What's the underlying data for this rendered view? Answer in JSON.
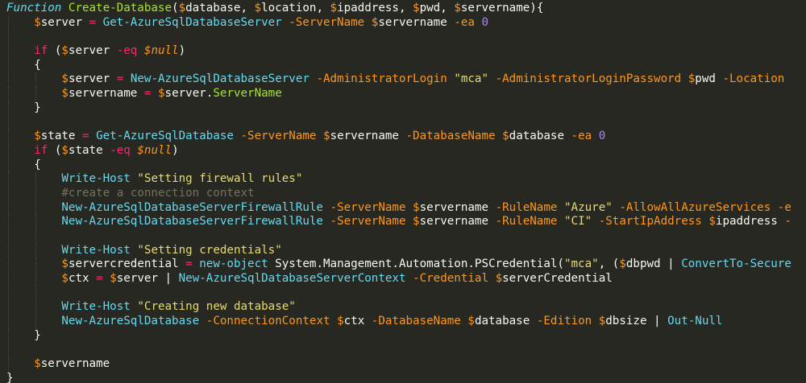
{
  "editor": {
    "theme_colors": {
      "background": "#272822",
      "keyword": "#f92672",
      "function_name": "#a6e22e",
      "cmdlet": "#66d9ef",
      "parameter": "#fd971f",
      "string": "#e6db74",
      "number": "#ae81ff",
      "comment": "#75715e",
      "text": "#f8f8f2"
    },
    "lines": [
      {
        "indent": 0,
        "tokens": [
          {
            "t": "kwi",
            "v": "Function"
          },
          {
            "t": "pun",
            "v": " "
          },
          {
            "t": "fn",
            "v": "Create-Database"
          },
          {
            "t": "pun",
            "v": "("
          },
          {
            "t": "sig",
            "v": "$"
          },
          {
            "t": "var",
            "v": "database"
          },
          {
            "t": "pun",
            "v": ", "
          },
          {
            "t": "sig",
            "v": "$"
          },
          {
            "t": "var",
            "v": "location"
          },
          {
            "t": "pun",
            "v": ", "
          },
          {
            "t": "sig",
            "v": "$"
          },
          {
            "t": "var",
            "v": "ipaddress"
          },
          {
            "t": "pun",
            "v": ", "
          },
          {
            "t": "sig",
            "v": "$"
          },
          {
            "t": "var",
            "v": "pwd"
          },
          {
            "t": "pun",
            "v": ", "
          },
          {
            "t": "sig",
            "v": "$"
          },
          {
            "t": "var",
            "v": "servername"
          },
          {
            "t": "pun",
            "v": "){"
          }
        ]
      },
      {
        "indent": 1,
        "tokens": [
          {
            "t": "sig",
            "v": "$"
          },
          {
            "t": "var",
            "v": "server"
          },
          {
            "t": "pun",
            "v": " "
          },
          {
            "t": "kw",
            "v": "="
          },
          {
            "t": "pun",
            "v": " "
          },
          {
            "t": "cmd",
            "v": "Get-AzureSqlDatabaseServer"
          },
          {
            "t": "pun",
            "v": " "
          },
          {
            "t": "par",
            "v": "-ServerName"
          },
          {
            "t": "pun",
            "v": " "
          },
          {
            "t": "sig",
            "v": "$"
          },
          {
            "t": "var",
            "v": "servername"
          },
          {
            "t": "pun",
            "v": " "
          },
          {
            "t": "par",
            "v": "-ea"
          },
          {
            "t": "pun",
            "v": " "
          },
          {
            "t": "num",
            "v": "0"
          }
        ]
      },
      {
        "indent": 1,
        "tokens": []
      },
      {
        "indent": 1,
        "tokens": [
          {
            "t": "kw",
            "v": "if"
          },
          {
            "t": "pun",
            "v": " ("
          },
          {
            "t": "sig",
            "v": "$"
          },
          {
            "t": "var",
            "v": "server"
          },
          {
            "t": "pun",
            "v": " "
          },
          {
            "t": "kw",
            "v": "-eq"
          },
          {
            "t": "pun",
            "v": " "
          },
          {
            "t": "sigi",
            "v": "$"
          },
          {
            "t": "sigi",
            "v": "null"
          },
          {
            "t": "pun",
            "v": ")"
          }
        ]
      },
      {
        "indent": 1,
        "tokens": [
          {
            "t": "pun",
            "v": "{"
          }
        ]
      },
      {
        "indent": 2,
        "tokens": [
          {
            "t": "sig",
            "v": "$"
          },
          {
            "t": "var",
            "v": "server"
          },
          {
            "t": "pun",
            "v": " "
          },
          {
            "t": "kw",
            "v": "="
          },
          {
            "t": "pun",
            "v": " "
          },
          {
            "t": "cmd",
            "v": "New-AzureSqlDatabaseServer"
          },
          {
            "t": "pun",
            "v": " "
          },
          {
            "t": "par",
            "v": "-AdministratorLogin"
          },
          {
            "t": "pun",
            "v": " "
          },
          {
            "t": "str",
            "v": "\"mca\""
          },
          {
            "t": "pun",
            "v": " "
          },
          {
            "t": "par",
            "v": "-AdministratorLoginPassword"
          },
          {
            "t": "pun",
            "v": " "
          },
          {
            "t": "sig",
            "v": "$"
          },
          {
            "t": "var",
            "v": "pwd"
          },
          {
            "t": "pun",
            "v": " "
          },
          {
            "t": "par",
            "v": "-Location"
          },
          {
            "t": "pun",
            "v": " "
          }
        ]
      },
      {
        "indent": 2,
        "tokens": [
          {
            "t": "sig",
            "v": "$"
          },
          {
            "t": "var",
            "v": "servername"
          },
          {
            "t": "pun",
            "v": " "
          },
          {
            "t": "kw",
            "v": "="
          },
          {
            "t": "pun",
            "v": " "
          },
          {
            "t": "sig",
            "v": "$"
          },
          {
            "t": "var",
            "v": "server"
          },
          {
            "t": "pun",
            "v": "."
          },
          {
            "t": "prop",
            "v": "ServerName"
          }
        ]
      },
      {
        "indent": 1,
        "tokens": [
          {
            "t": "pun",
            "v": "}"
          }
        ]
      },
      {
        "indent": 1,
        "tokens": []
      },
      {
        "indent": 1,
        "tokens": [
          {
            "t": "sig",
            "v": "$"
          },
          {
            "t": "var",
            "v": "state"
          },
          {
            "t": "pun",
            "v": " "
          },
          {
            "t": "kw",
            "v": "="
          },
          {
            "t": "pun",
            "v": " "
          },
          {
            "t": "cmd",
            "v": "Get-AzureSqlDatabase"
          },
          {
            "t": "pun",
            "v": " "
          },
          {
            "t": "par",
            "v": "-ServerName"
          },
          {
            "t": "pun",
            "v": " "
          },
          {
            "t": "sig",
            "v": "$"
          },
          {
            "t": "var",
            "v": "servername"
          },
          {
            "t": "pun",
            "v": " "
          },
          {
            "t": "par",
            "v": "-DatabaseName"
          },
          {
            "t": "pun",
            "v": " "
          },
          {
            "t": "sig",
            "v": "$"
          },
          {
            "t": "var",
            "v": "database"
          },
          {
            "t": "pun",
            "v": " "
          },
          {
            "t": "par",
            "v": "-ea"
          },
          {
            "t": "pun",
            "v": " "
          },
          {
            "t": "num",
            "v": "0"
          }
        ]
      },
      {
        "indent": 1,
        "tokens": [
          {
            "t": "kw",
            "v": "if"
          },
          {
            "t": "pun",
            "v": " ("
          },
          {
            "t": "sig",
            "v": "$"
          },
          {
            "t": "var",
            "v": "state"
          },
          {
            "t": "pun",
            "v": " "
          },
          {
            "t": "kw",
            "v": "-eq"
          },
          {
            "t": "pun",
            "v": " "
          },
          {
            "t": "sigi",
            "v": "$"
          },
          {
            "t": "sigi",
            "v": "null"
          },
          {
            "t": "pun",
            "v": ")"
          }
        ]
      },
      {
        "indent": 1,
        "tokens": [
          {
            "t": "pun",
            "v": "{"
          }
        ]
      },
      {
        "indent": 2,
        "tokens": [
          {
            "t": "cmd",
            "v": "Write-Host"
          },
          {
            "t": "pun",
            "v": " "
          },
          {
            "t": "str",
            "v": "\"Setting firewall rules\""
          }
        ]
      },
      {
        "indent": 2,
        "tokens": [
          {
            "t": "cmt",
            "v": "#create a connection context"
          }
        ]
      },
      {
        "indent": 2,
        "tokens": [
          {
            "t": "cmd",
            "v": "New-AzureSqlDatabaseServerFirewallRule"
          },
          {
            "t": "pun",
            "v": " "
          },
          {
            "t": "par",
            "v": "-ServerName"
          },
          {
            "t": "pun",
            "v": " "
          },
          {
            "t": "sig",
            "v": "$"
          },
          {
            "t": "var",
            "v": "servername"
          },
          {
            "t": "pun",
            "v": " "
          },
          {
            "t": "par",
            "v": "-RuleName"
          },
          {
            "t": "pun",
            "v": " "
          },
          {
            "t": "str",
            "v": "\"Azure\""
          },
          {
            "t": "pun",
            "v": " "
          },
          {
            "t": "par",
            "v": "-AllowAllAzureServices"
          },
          {
            "t": "pun",
            "v": " "
          },
          {
            "t": "par",
            "v": "-e"
          }
        ]
      },
      {
        "indent": 2,
        "tokens": [
          {
            "t": "cmd",
            "v": "New-AzureSqlDatabaseServerFirewallRule"
          },
          {
            "t": "pun",
            "v": " "
          },
          {
            "t": "par",
            "v": "-ServerName"
          },
          {
            "t": "pun",
            "v": " "
          },
          {
            "t": "sig",
            "v": "$"
          },
          {
            "t": "var",
            "v": "servername"
          },
          {
            "t": "pun",
            "v": " "
          },
          {
            "t": "par",
            "v": "-RuleName"
          },
          {
            "t": "pun",
            "v": " "
          },
          {
            "t": "str",
            "v": "\"CI\""
          },
          {
            "t": "pun",
            "v": " "
          },
          {
            "t": "par",
            "v": "-StartIpAddress"
          },
          {
            "t": "pun",
            "v": " "
          },
          {
            "t": "sig",
            "v": "$"
          },
          {
            "t": "var",
            "v": "ipaddress"
          },
          {
            "t": "pun",
            "v": " "
          },
          {
            "t": "par",
            "v": "-"
          }
        ]
      },
      {
        "indent": 2,
        "tokens": []
      },
      {
        "indent": 2,
        "tokens": [
          {
            "t": "cmd",
            "v": "Write-Host"
          },
          {
            "t": "pun",
            "v": " "
          },
          {
            "t": "str",
            "v": "\"Setting credentials\""
          }
        ]
      },
      {
        "indent": 2,
        "tokens": [
          {
            "t": "sig",
            "v": "$"
          },
          {
            "t": "var",
            "v": "servercredential"
          },
          {
            "t": "pun",
            "v": " "
          },
          {
            "t": "kw",
            "v": "="
          },
          {
            "t": "pun",
            "v": " "
          },
          {
            "t": "cmd",
            "v": "new-object"
          },
          {
            "t": "pun",
            "v": " System.Management.Automation.PSCredential("
          },
          {
            "t": "str",
            "v": "\"mca\""
          },
          {
            "t": "pun",
            "v": ", ("
          },
          {
            "t": "sig",
            "v": "$"
          },
          {
            "t": "var",
            "v": "dbpwd"
          },
          {
            "t": "pun",
            "v": " | "
          },
          {
            "t": "cmd",
            "v": "ConvertTo-Secure"
          }
        ]
      },
      {
        "indent": 2,
        "tokens": [
          {
            "t": "sig",
            "v": "$"
          },
          {
            "t": "var",
            "v": "ctx"
          },
          {
            "t": "pun",
            "v": " "
          },
          {
            "t": "kw",
            "v": "="
          },
          {
            "t": "pun",
            "v": " "
          },
          {
            "t": "sig",
            "v": "$"
          },
          {
            "t": "var",
            "v": "server"
          },
          {
            "t": "pun",
            "v": " | "
          },
          {
            "t": "cmd",
            "v": "New-AzureSqlDatabaseServerContext"
          },
          {
            "t": "pun",
            "v": " "
          },
          {
            "t": "par",
            "v": "-Credential"
          },
          {
            "t": "pun",
            "v": " "
          },
          {
            "t": "sig",
            "v": "$"
          },
          {
            "t": "var",
            "v": "serverCredential"
          }
        ]
      },
      {
        "indent": 2,
        "tokens": []
      },
      {
        "indent": 2,
        "tokens": [
          {
            "t": "cmd",
            "v": "Write-Host"
          },
          {
            "t": "pun",
            "v": " "
          },
          {
            "t": "str",
            "v": "\"Creating new database\""
          }
        ]
      },
      {
        "indent": 2,
        "tokens": [
          {
            "t": "cmd",
            "v": "New-AzureSqlDatabase"
          },
          {
            "t": "pun",
            "v": " "
          },
          {
            "t": "par",
            "v": "-ConnectionContext"
          },
          {
            "t": "pun",
            "v": " "
          },
          {
            "t": "sig",
            "v": "$"
          },
          {
            "t": "var",
            "v": "ctx"
          },
          {
            "t": "pun",
            "v": " "
          },
          {
            "t": "par",
            "v": "-DatabaseName"
          },
          {
            "t": "pun",
            "v": " "
          },
          {
            "t": "sig",
            "v": "$"
          },
          {
            "t": "var",
            "v": "database"
          },
          {
            "t": "pun",
            "v": " "
          },
          {
            "t": "par",
            "v": "-Edition"
          },
          {
            "t": "pun",
            "v": " "
          },
          {
            "t": "sig",
            "v": "$"
          },
          {
            "t": "var",
            "v": "dbsize"
          },
          {
            "t": "pun",
            "v": " | "
          },
          {
            "t": "cmd",
            "v": "Out-Null"
          }
        ]
      },
      {
        "indent": 1,
        "tokens": [
          {
            "t": "pun",
            "v": "}"
          }
        ]
      },
      {
        "indent": 1,
        "tokens": []
      },
      {
        "indent": 1,
        "tokens": [
          {
            "t": "sig",
            "v": "$"
          },
          {
            "t": "var",
            "v": "servername"
          }
        ]
      },
      {
        "indent": 0,
        "tokens": [
          {
            "t": "pun",
            "v": "}"
          }
        ]
      }
    ]
  }
}
